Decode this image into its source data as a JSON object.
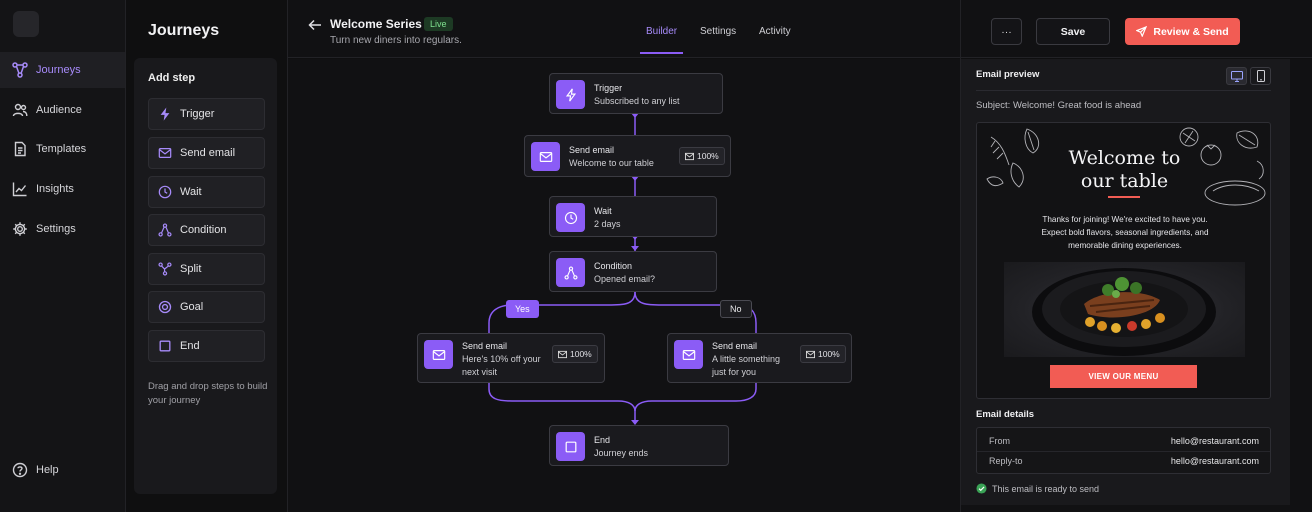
{
  "nav": {
    "items": [
      {
        "label": "Journeys",
        "icon": "journeys-icon",
        "active": true
      },
      {
        "label": "Audience",
        "icon": "users-icon"
      },
      {
        "label": "Templates",
        "icon": "document-icon"
      },
      {
        "label": "Insights",
        "icon": "chart-icon"
      },
      {
        "label": "Settings",
        "icon": "gear-icon"
      }
    ],
    "help_label": "Help"
  },
  "steps": {
    "title": "Journeys",
    "add_step": "Add step",
    "items": [
      {
        "label": "Trigger",
        "icon": "bolt-icon"
      },
      {
        "label": "Send email",
        "icon": "mail-icon"
      },
      {
        "label": "Wait",
        "icon": "clock-icon"
      },
      {
        "label": "Condition",
        "icon": "branch-icon"
      },
      {
        "label": "Split",
        "icon": "split-icon"
      },
      {
        "label": "Goal",
        "icon": "target-icon"
      },
      {
        "label": "End",
        "icon": "square-icon"
      }
    ],
    "hint": "Drag and drop steps to build your journey"
  },
  "header": {
    "title": "Welcome Series",
    "status": "Live",
    "subtitle": "Turn new diners into regulars.",
    "tabs": [
      "Builder",
      "Settings",
      "Activity"
    ],
    "active_tab": "Builder",
    "more_label": "···",
    "save_label": "Save",
    "send_label": "Review & Send"
  },
  "flow": {
    "trigger": {
      "title": "Trigger",
      "desc": "Subscribed to any list"
    },
    "email1": {
      "title": "Send email",
      "desc": "Welcome to our table",
      "pct": "100%"
    },
    "wait": {
      "title": "Wait",
      "desc": "2 days"
    },
    "condition": {
      "title": "Condition",
      "desc": "Opened email?"
    },
    "yes_label": "Yes",
    "no_label": "No",
    "email_yes": {
      "title": "Send email",
      "desc1": "Here's 10% off your",
      "desc2": "next visit",
      "pct": "100%"
    },
    "email_no": {
      "title": "Send email",
      "desc1": "A little something",
      "desc2": "just for you",
      "pct": "100%"
    },
    "end": {
      "title": "End",
      "desc": "Journey ends"
    }
  },
  "preview": {
    "title": "Email preview",
    "subject_label": "Subject:",
    "subject": "Welcome! Great food is ahead",
    "headline1": "Welcome to",
    "headline2": "our table",
    "body1": "Thanks for joining! We're excited to have you.",
    "body2": "Expect bold flavors, seasonal ingredients, and",
    "body3": "memorable dining experiences.",
    "cta": "VIEW OUR MENU",
    "details_title": "Email details",
    "from_label": "From",
    "from_value": "hello@restaurant.com",
    "reply_label": "Reply-to",
    "reply_value": "hello@restaurant.com",
    "ready_text": "This email is ready to send"
  },
  "colors": {
    "accent": "#8b5cf6",
    "send": "#f25c54",
    "live": "#7ee08f"
  }
}
